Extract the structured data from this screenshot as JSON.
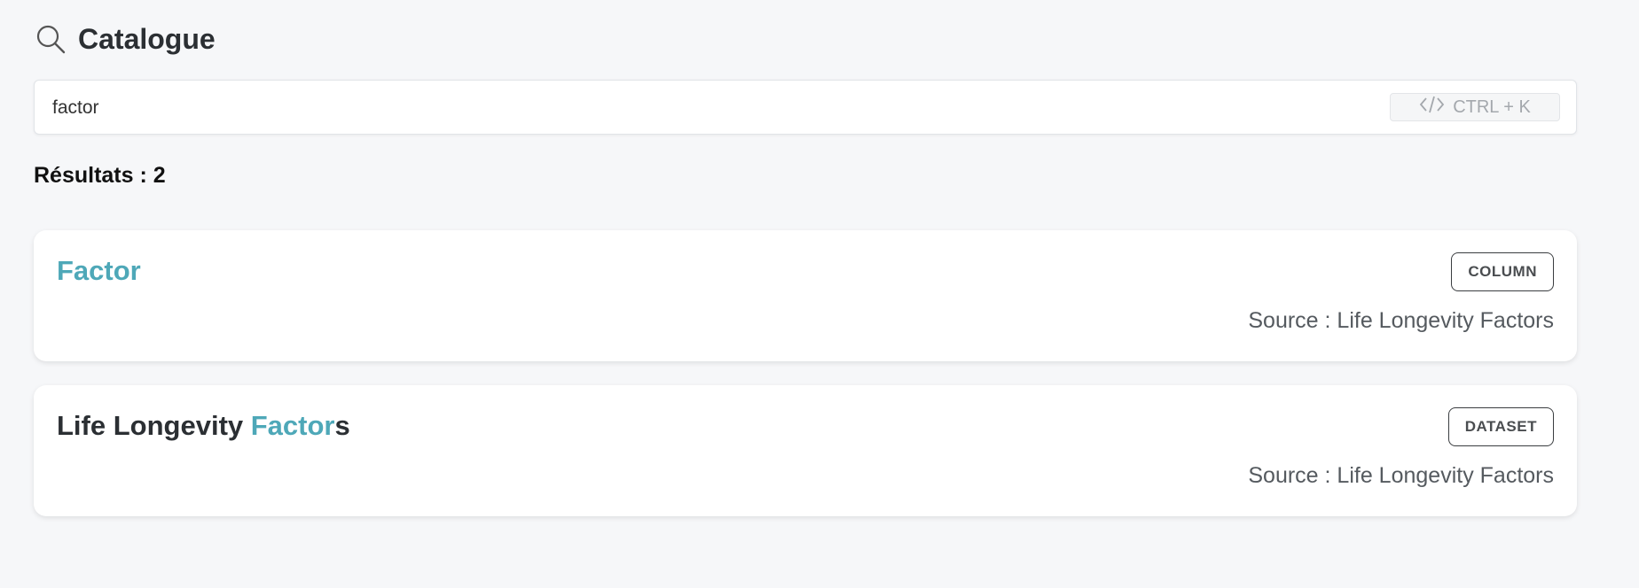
{
  "header": {
    "title": "Catalogue",
    "icon": "search-icon"
  },
  "search": {
    "value": "factor",
    "placeholder": "",
    "shortcut_label": "CTRL + K",
    "shortcut_icon": "code-icon"
  },
  "results": {
    "label": "Résultats : 2"
  },
  "items": [
    {
      "title_before": "",
      "title_match": "Factor",
      "title_after": "",
      "badge": "COLUMN",
      "source": "Source : Life Longevity Factors"
    },
    {
      "title_before": "Life Longevity ",
      "title_match": "Factor",
      "title_after": "s",
      "badge": "DATASET",
      "source": "Source : Life Longevity Factors"
    }
  ],
  "colors": {
    "highlight": "#4ea8b8",
    "background": "#f6f7f9",
    "text": "#2b2f33"
  }
}
